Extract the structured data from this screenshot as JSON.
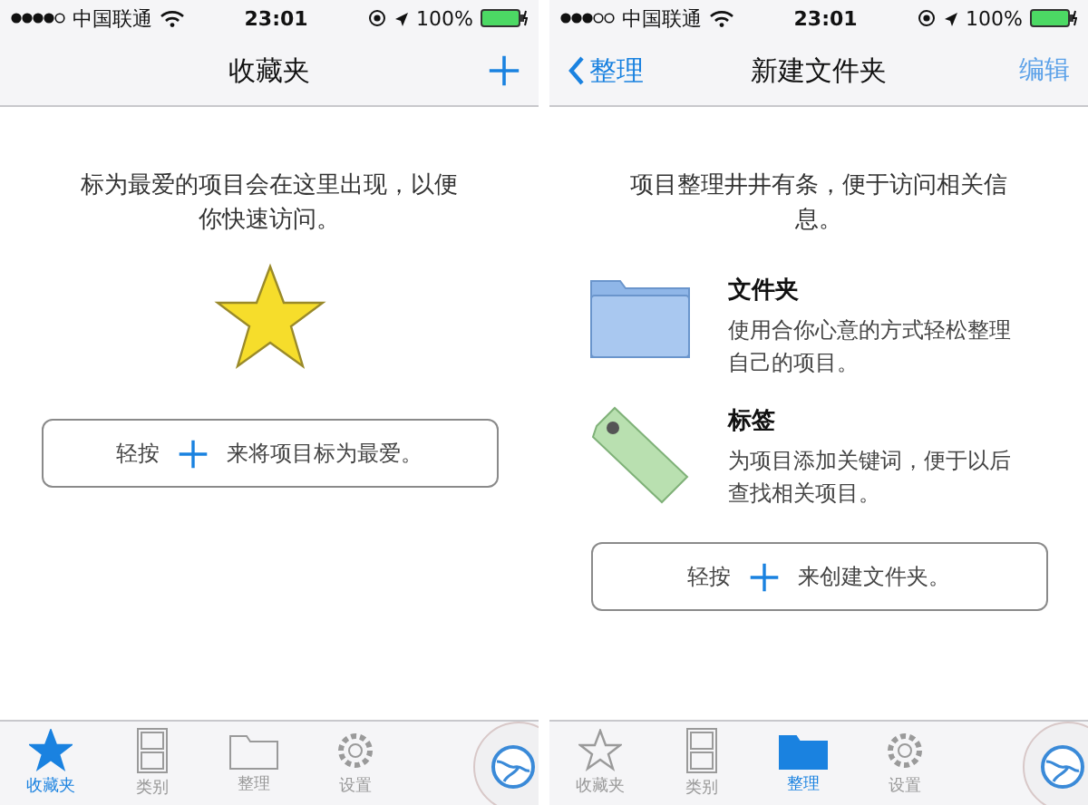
{
  "screens": [
    {
      "kind": "favorites",
      "status_bar": {
        "carrier": "中国联通",
        "time": "23:01",
        "battery": "100%"
      },
      "nav": {
        "title": "收藏夹",
        "add_button": true
      },
      "intro": "标为最爱的项目会在这里出现，以便你快速访问。",
      "hint": {
        "before": "轻按",
        "after": "来将项目标为最爱。"
      },
      "tabs": [
        {
          "label": "收藏夹",
          "selected": true
        },
        {
          "label": "类别",
          "selected": false
        },
        {
          "label": "整理",
          "selected": false
        },
        {
          "label": "设置",
          "selected": false
        }
      ]
    },
    {
      "kind": "organize",
      "status_bar": {
        "carrier": "中国联通",
        "time": "23:01",
        "battery": "100%"
      },
      "nav": {
        "back": "整理",
        "title": "新建文件夹",
        "action": "编辑"
      },
      "intro": "项目整理井井有条，便于访问相关信息。",
      "items": [
        {
          "kind": "folder",
          "title": "文件夹",
          "text": "使用合你心意的方式轻松整理自己的项目。"
        },
        {
          "kind": "tag",
          "title": "标签",
          "text": "为项目添加关键词，便于以后查找相关项目。"
        }
      ],
      "hint": {
        "before": "轻按",
        "after": "来创建文件夹。"
      },
      "tabs": [
        {
          "label": "收藏夹",
          "selected": false
        },
        {
          "label": "类别",
          "selected": false
        },
        {
          "label": "整理",
          "selected": true
        },
        {
          "label": "设置",
          "selected": false
        }
      ]
    }
  ]
}
